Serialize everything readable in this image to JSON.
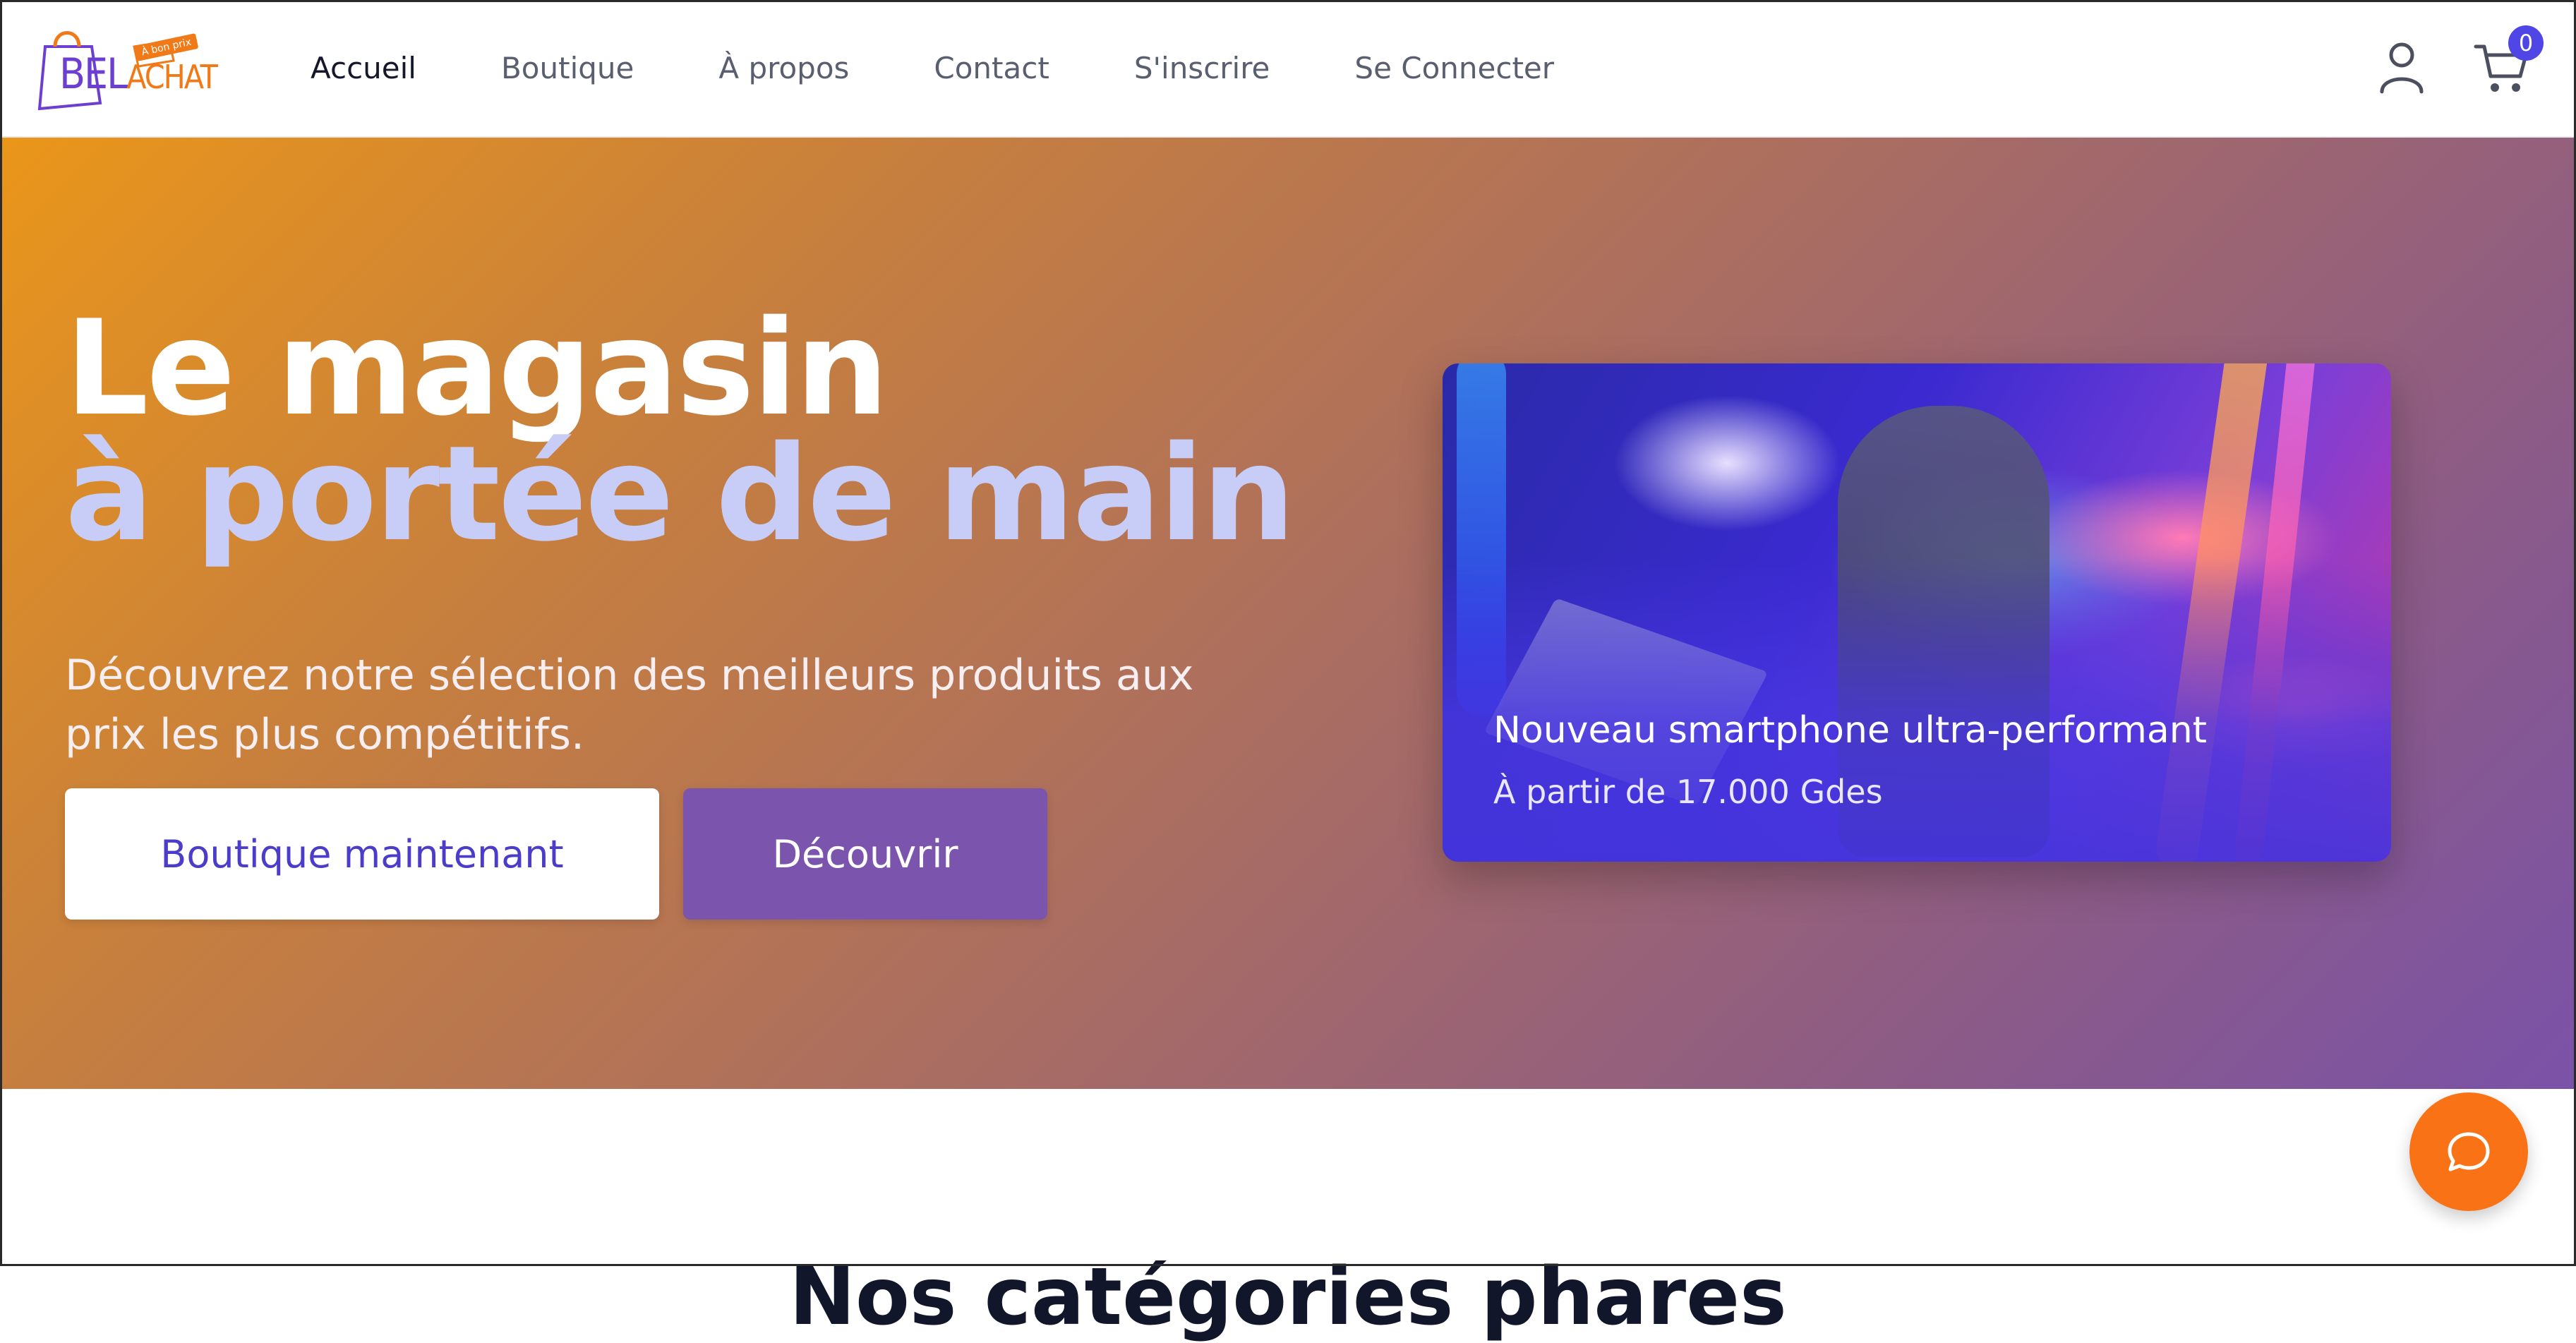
{
  "header": {
    "logo_text_main": "BEL",
    "logo_text_accent": "ACHAT",
    "logo_tagline": "À bon prix",
    "nav": [
      {
        "label": "Accueil",
        "active": true
      },
      {
        "label": "Boutique",
        "active": false
      },
      {
        "label": "À propos",
        "active": false
      },
      {
        "label": "Contact",
        "active": false
      },
      {
        "label": "S'inscrire",
        "active": false
      },
      {
        "label": "Se Connecter",
        "active": false
      }
    ],
    "cart_count": "0",
    "icons": [
      "user-icon",
      "cart-icon"
    ]
  },
  "hero": {
    "title_line1": "Le magasin",
    "title_line2": "à portée de main",
    "subtitle": "Découvrez notre sélection des meilleurs produits aux prix les plus compétitifs.",
    "primary_button": "Boutique maintenant",
    "secondary_button": "Découvrir",
    "promo": {
      "title": "Nouveau smartphone ultra-performant",
      "price": "À partir de 17.000 Gdes"
    }
  },
  "section": {
    "title": "Nos catégories phares"
  },
  "chat": {
    "icon": "chat-bubble-icon"
  },
  "colors": {
    "accent": "#4f46e5",
    "orange": "#f97316",
    "hero_start": "#ea961a",
    "hero_end": "#7a52a8",
    "title_highlight": "#c7cdf7"
  }
}
